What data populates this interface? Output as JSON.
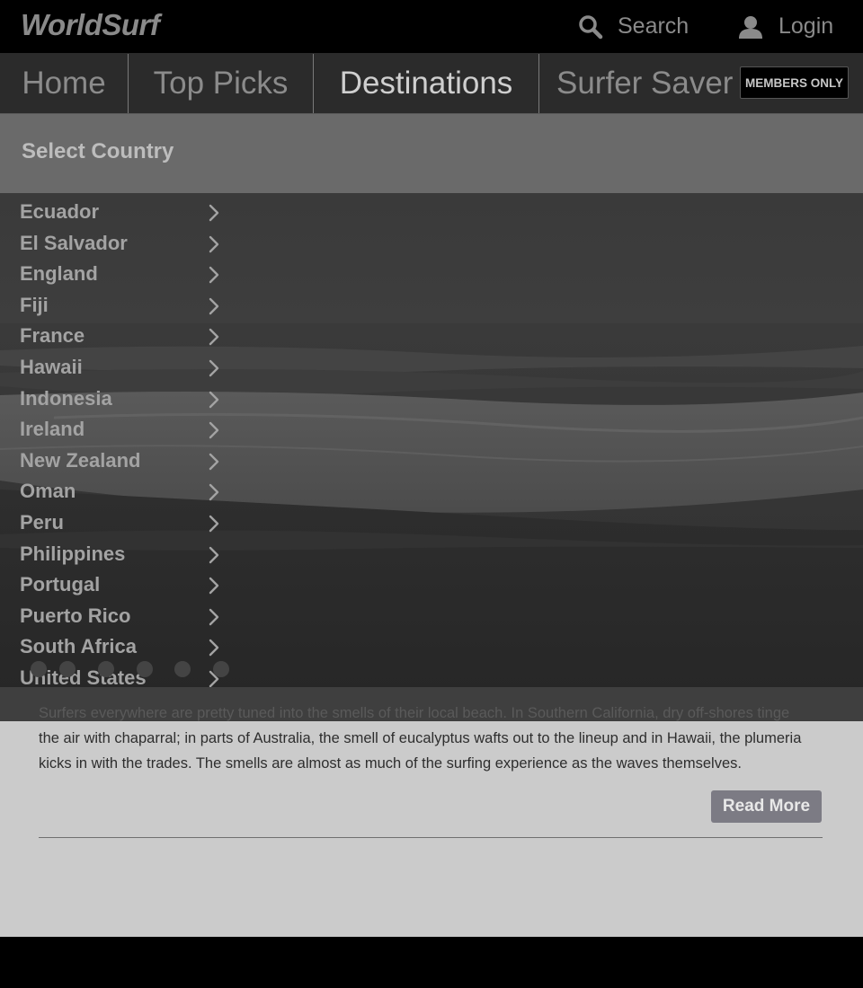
{
  "app": {
    "logo": "WorldSurf",
    "search_label": "Search",
    "login_label": "Login"
  },
  "nav": {
    "items": [
      {
        "label": "Home"
      },
      {
        "label": "Top Picks"
      },
      {
        "label": "Destinations",
        "active": true
      },
      {
        "label": "Surfer Saver"
      }
    ],
    "badge": "MEMBERS ONLY"
  },
  "country_panel": {
    "title": "Select Country",
    "countries": [
      "Ecuador",
      "El Salvador",
      "England",
      "Fiji",
      "France",
      "Hawaii",
      "Indonesia",
      "Ireland",
      "New Zealand",
      "Oman",
      "Peru",
      "Philippines",
      "Portugal",
      "Puerto Rico",
      "South Africa",
      "United States"
    ]
  },
  "carousel": {
    "dot_count": 6
  },
  "article": {
    "body_line1": "Surfers everywhere are pretty tuned into the smells of their local beach. In Southern California, dry off-shores tinge",
    "body_rest": "the air with chaparral; in parts of Australia, the smell of eucalyptus wafts out to the lineup and in Hawaii, the plumeria kicks in with the trades. The smells are almost as much of the surfing experience as the waves themselves.",
    "read_more": "Read More"
  },
  "colors": {
    "nav_bg": "#2b2b2b",
    "panel_header_bg": "#6a6a6a",
    "article_bg": "#cbcbcb",
    "read_more_bg": "#7c7b84"
  }
}
